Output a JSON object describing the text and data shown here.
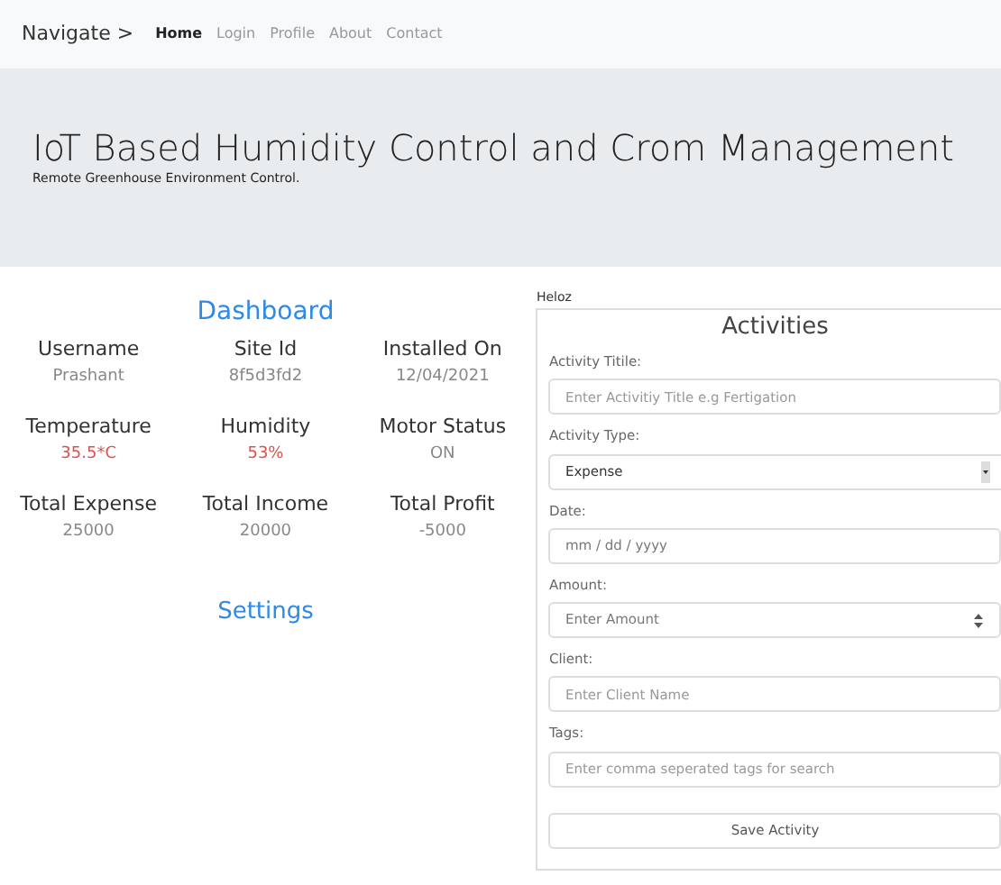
{
  "navbar": {
    "brand": "Navigate >",
    "links": [
      {
        "label": "Home",
        "selected": true
      },
      {
        "label": "Login",
        "selected": false
      },
      {
        "label": "Profile",
        "selected": false
      },
      {
        "label": "About",
        "selected": false
      },
      {
        "label": "Contact",
        "selected": false
      }
    ]
  },
  "header": {
    "title": "IoT Based Humidity Control and Crom Management",
    "subtitle": "Remote Greenhouse Environment Control."
  },
  "dashboard": {
    "title": "Dashboard",
    "stats": [
      {
        "label": "Username",
        "value": "Prashant",
        "color": "#888888"
      },
      {
        "label": "Site Id",
        "value": "8f5d3fd2",
        "color": "#888888"
      },
      {
        "label": "Installed On",
        "value": "12/04/2021",
        "color": "#888888"
      },
      {
        "label": "Temperature",
        "value": "35.5*C",
        "color": "#d9534f"
      },
      {
        "label": "Humidity",
        "value": "53%",
        "color": "#d9534f"
      },
      {
        "label": "Motor Status",
        "value": "ON",
        "color": "#888888"
      },
      {
        "label": "Total Expense",
        "value": "25000",
        "color": "#888888"
      },
      {
        "label": "Total Income",
        "value": "20000",
        "color": "#888888"
      },
      {
        "label": "Total Profit",
        "value": "-5000",
        "color": "#888888"
      }
    ],
    "settings": "Settings"
  },
  "activities": {
    "greeting": "Heloz",
    "title": "Activities",
    "fields": [
      {
        "kind": "text",
        "label": "Activity Titile:",
        "placeholder": "Enter Activitiy Title e.g Fertigation"
      },
      {
        "kind": "select",
        "label": "Activity Type:",
        "value": "Expense"
      },
      {
        "kind": "date",
        "label": "Date:",
        "placeholder": "mm / dd / yyyy"
      },
      {
        "kind": "number",
        "label": "Amount:",
        "placeholder": "Enter Amount"
      },
      {
        "kind": "text",
        "label": "Client:",
        "placeholder": "Enter Client Name"
      },
      {
        "kind": "text",
        "label": "Tags:",
        "placeholder": "Enter comma seperated tags for search"
      }
    ],
    "button": "Save Activity"
  }
}
